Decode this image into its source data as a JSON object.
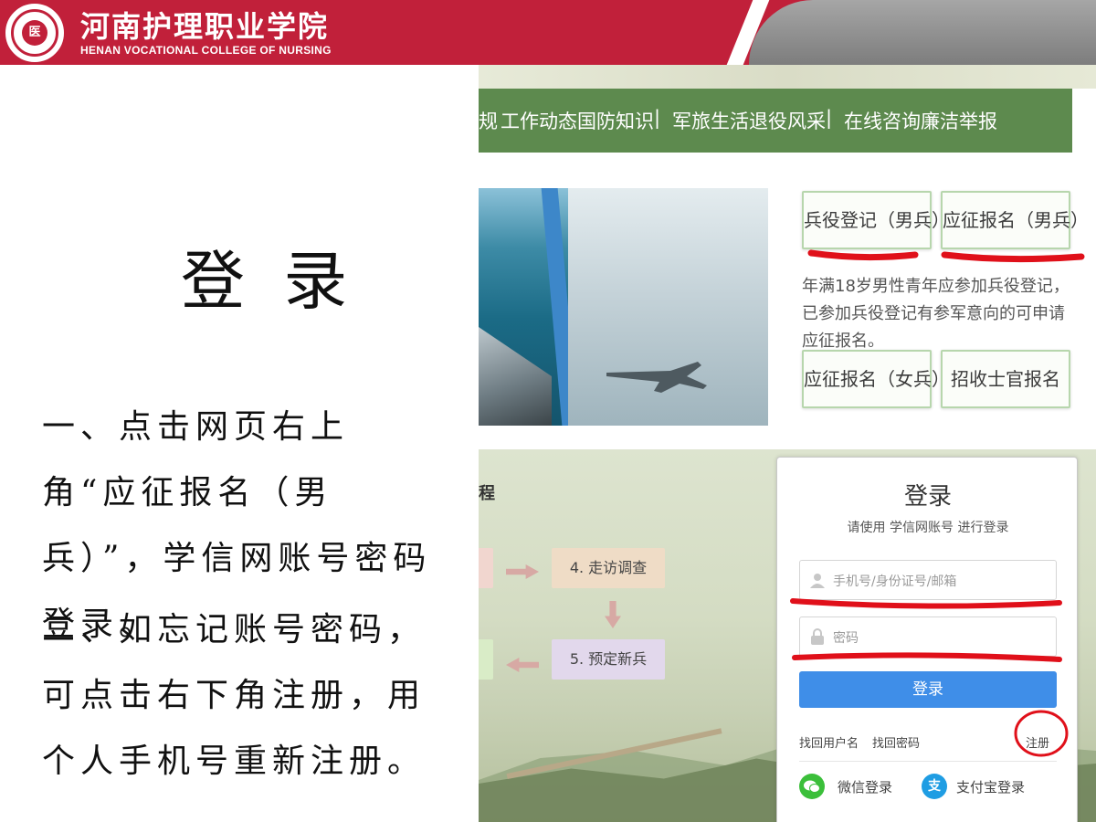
{
  "header": {
    "college_name_cn": "河南护理职业学院",
    "college_name_en": "HENAN VOCATIONAL COLLEGE OF NURSING",
    "logo_mark": "医"
  },
  "slide": {
    "title": "登 录",
    "step1": "一、点击网页右上角“应征报名（男兵）”，学信网账号密码登录。",
    "step2": "二、如忘记账号密码，可点击右下角注册，用个人手机号重新注册。"
  },
  "recruit_site": {
    "nav_items": [
      "规",
      "工作动态",
      "国防知识",
      "|",
      "军旅生活",
      "退役风采",
      "|",
      "在线咨询",
      "廉洁举报"
    ],
    "buttons": {
      "register_male": "兵役登记（男兵）",
      "apply_male": "应征报名（男兵）",
      "apply_female": "应征报名（女兵）",
      "nco_recruit": "招收士官报名"
    },
    "description": "年满18岁男性青年应参加兵役登记，已参加兵役登记有参军意向的可申请应征报名。"
  },
  "login_page": {
    "flow_label": "程",
    "flow_steps": {
      "step4": "4. 走访调查",
      "step5": "5. 预定新兵"
    },
    "title": "登录",
    "subtitle": "请使用  学信网账号  进行登录",
    "username_placeholder": "手机号/身份证号/邮箱",
    "password_placeholder": "密码",
    "login_button": "登录",
    "find_username": "找回用户名",
    "find_password": "找回密码",
    "register": "注册",
    "wechat_login": "微信登录",
    "alipay_login": "支付宝登录",
    "alipay_icon_char": "支"
  },
  "colors": {
    "header_red": "#c1203a",
    "nav_green": "#5d8a4e",
    "login_blue": "#3f8ee8",
    "annotation_red": "#e0101a"
  }
}
